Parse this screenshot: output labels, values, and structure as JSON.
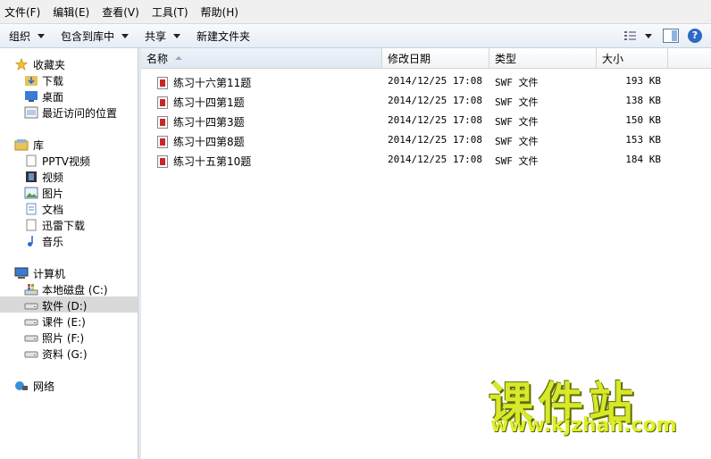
{
  "menu": [
    "文件(F)",
    "编辑(E)",
    "查看(V)",
    "工具(T)",
    "帮助(H)"
  ],
  "toolbar": {
    "organize": "组织",
    "include_in_library": "包含到库中",
    "share": "共享",
    "new_folder": "新建文件夹",
    "help": "?"
  },
  "nav": {
    "favorites": {
      "label": "收藏夹",
      "items": [
        "下载",
        "桌面",
        "最近访问的位置"
      ]
    },
    "libraries": {
      "label": "库",
      "items": [
        "PPTV视频",
        "视频",
        "图片",
        "文档",
        "迅雷下载",
        "音乐"
      ]
    },
    "computer": {
      "label": "计算机",
      "items": [
        "本地磁盘 (C:)",
        "软件 (D:)",
        "课件 (E:)",
        "照片 (F:)",
        "资料 (G:)"
      ],
      "selected": "软件 (D:)"
    },
    "network": {
      "label": "网络"
    }
  },
  "columns": {
    "name": "名称",
    "date": "修改日期",
    "type": "类型",
    "size": "大小"
  },
  "files": [
    {
      "name": "练习十六第11题",
      "date": "2014/12/25 17:08",
      "type": "SWF 文件",
      "size": "193 KB"
    },
    {
      "name": "练习十四第1题",
      "date": "2014/12/25 17:08",
      "type": "SWF 文件",
      "size": "138 KB"
    },
    {
      "name": "练习十四第3题",
      "date": "2014/12/25 17:08",
      "type": "SWF 文件",
      "size": "150 KB"
    },
    {
      "name": "练习十四第8题",
      "date": "2014/12/25 17:08",
      "type": "SWF 文件",
      "size": "153 KB"
    },
    {
      "name": "练习十五第10题",
      "date": "2014/12/25 17:08",
      "type": "SWF 文件",
      "size": "184 KB"
    }
  ],
  "watermark": {
    "title": "课件站",
    "url": "www.kjzhan.com"
  },
  "colors": {
    "selection": "#d9d9d9",
    "watermark": "#d8e82a"
  }
}
